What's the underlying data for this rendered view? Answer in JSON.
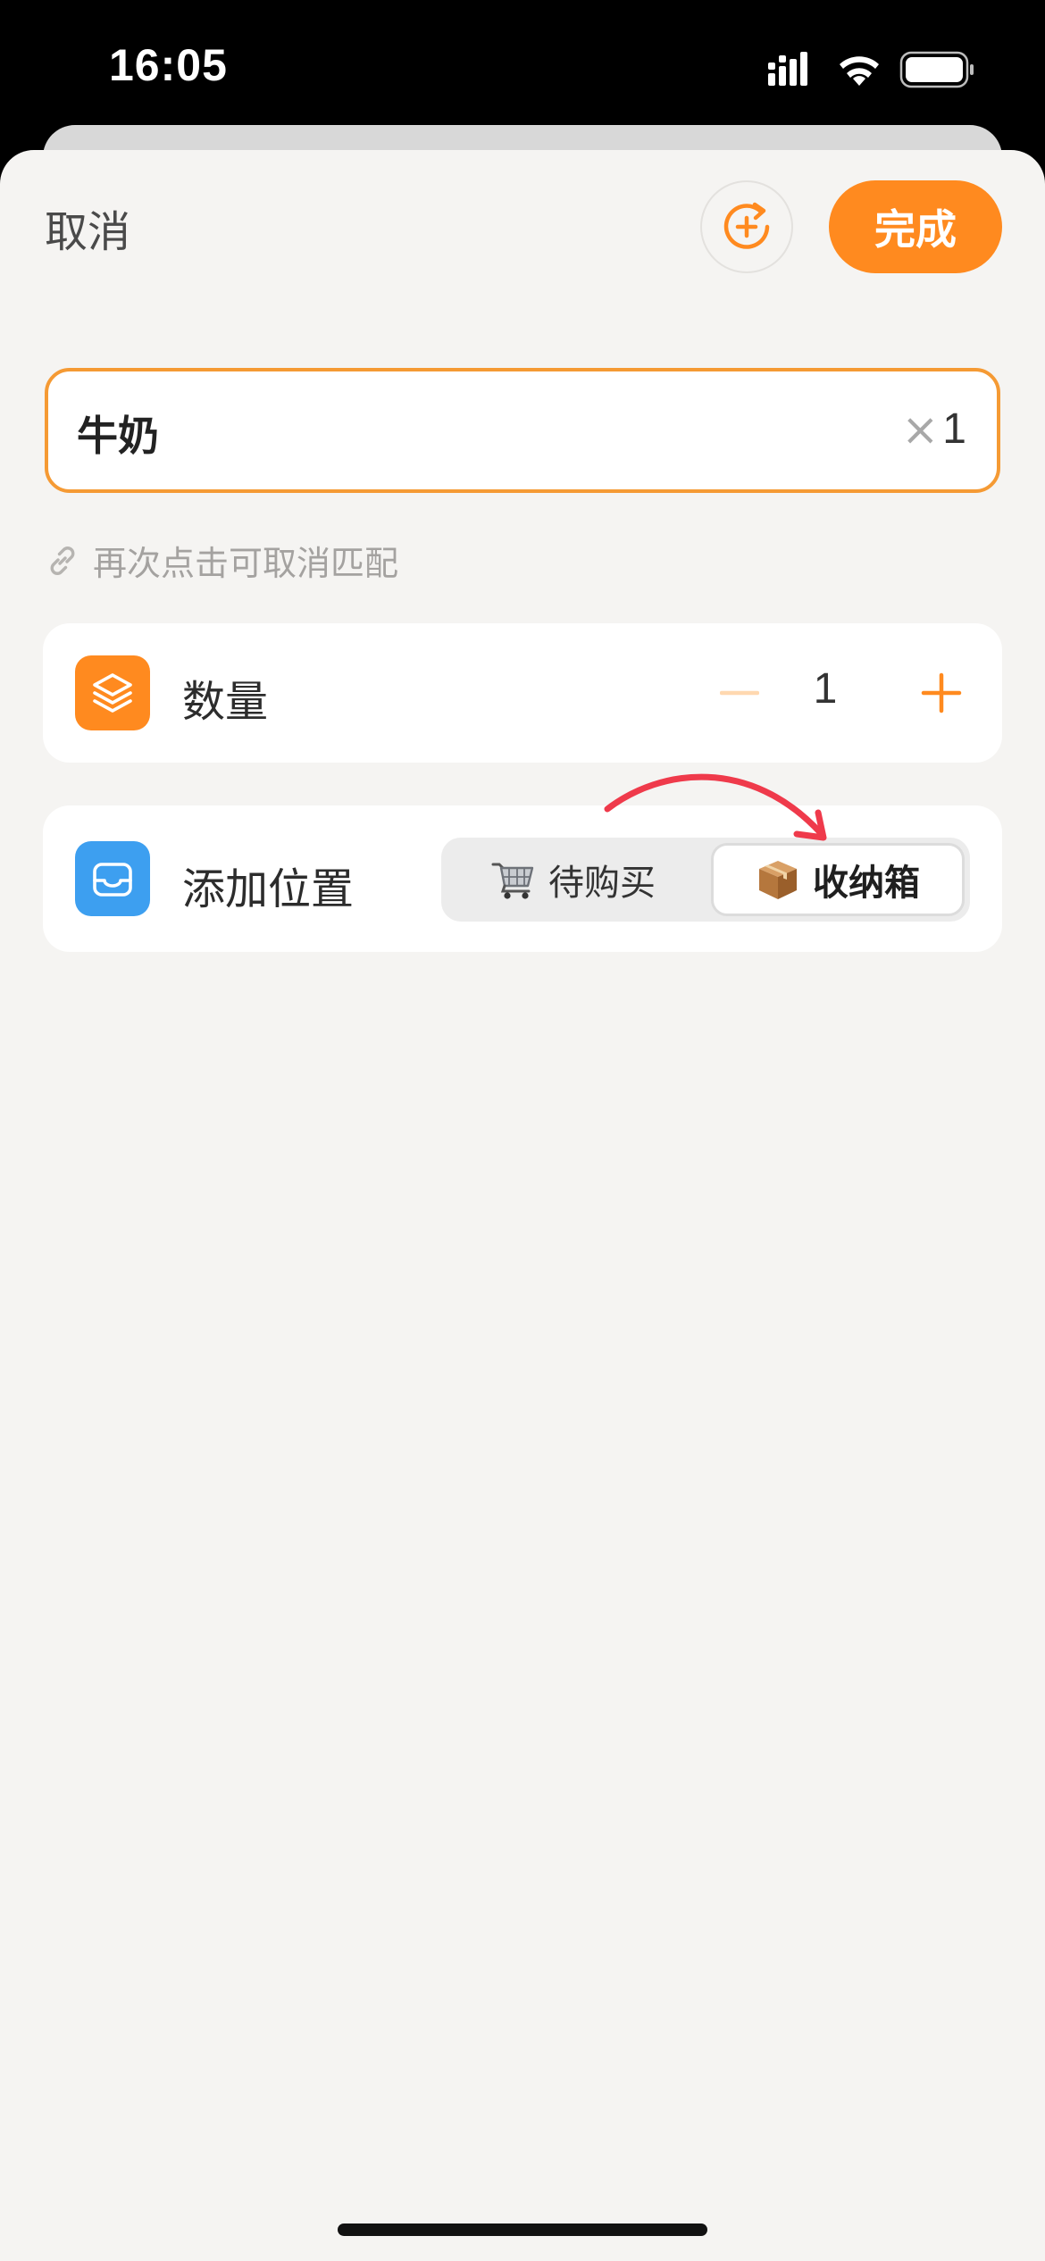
{
  "status": {
    "time": "16:05"
  },
  "header": {
    "cancel_label": "取消",
    "done_label": "完成"
  },
  "item": {
    "name": "牛奶",
    "qty_prefix": "×",
    "qty_value": "1"
  },
  "hint": {
    "text": "再次点击可取消匹配"
  },
  "quantity_row": {
    "label": "数量",
    "value": "1"
  },
  "location_row": {
    "label": "添加位置",
    "options": [
      {
        "label": "待购买",
        "icon": "cart-icon",
        "selected": false
      },
      {
        "label": "收纳箱",
        "icon": "package-box-icon",
        "selected": true
      }
    ]
  },
  "colors": {
    "accent": "#ff8a1f",
    "accent_border": "#f59a34",
    "location_icon_bg": "#3d9ff0",
    "annotation_arrow": "#ef3a4b"
  }
}
